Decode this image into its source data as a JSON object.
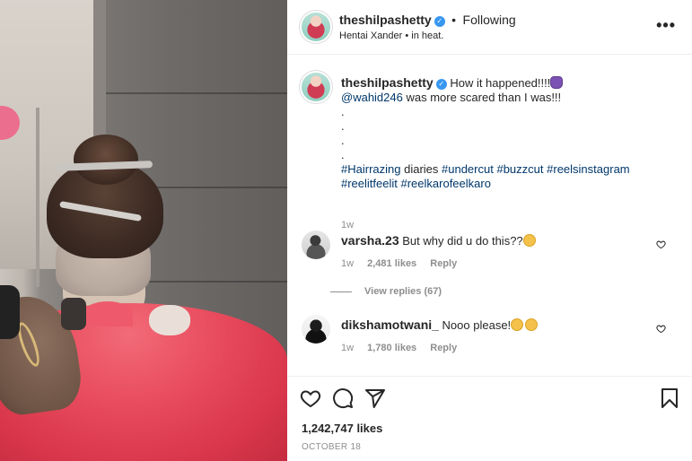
{
  "post": {
    "username": "theshilpashetty",
    "verified": true,
    "dot": "•",
    "follow_status": "Following",
    "audio": "Hentai Xander • in heat.",
    "more_icon": "more-horizontal-icon"
  },
  "caption": {
    "username": "theshilpashetty",
    "line1": "How it happened!!!!",
    "mention": "@wahid246",
    "line2_rest": " was more scared than I was!!!",
    "dots": [
      ".",
      ".",
      ".",
      "."
    ],
    "hashtag1": "#Hairrazing",
    "word_diaries": " diaries ",
    "hashtag2": "#undercut",
    "hashtag3": "#buzzcut",
    "hashtag4": "#reelsinstagram",
    "hashtag5": "#reelitfeelit",
    "hashtag6": "#reelkarofeelkaro",
    "time": "1w"
  },
  "comments": [
    {
      "username": "varsha.23",
      "text": "But why did u do this??",
      "time": "1w",
      "likes": "2,481 likes",
      "reply": "Reply",
      "view_replies": "View replies (67)"
    },
    {
      "username": "dikshamotwani_",
      "text": "Nooo please!",
      "time": "1w",
      "likes": "1,780 likes",
      "reply": "Reply"
    }
  ],
  "actions": {
    "like_icon": "heart-icon",
    "comment_icon": "comment-icon",
    "share_icon": "share-icon",
    "save_icon": "bookmark-icon"
  },
  "likes": "1,242,747 likes",
  "date": "OCTOBER 18",
  "colors": {
    "link": "#00376b",
    "verified": "#3897f0",
    "muted": "#8e8e8e",
    "text": "#262626"
  }
}
